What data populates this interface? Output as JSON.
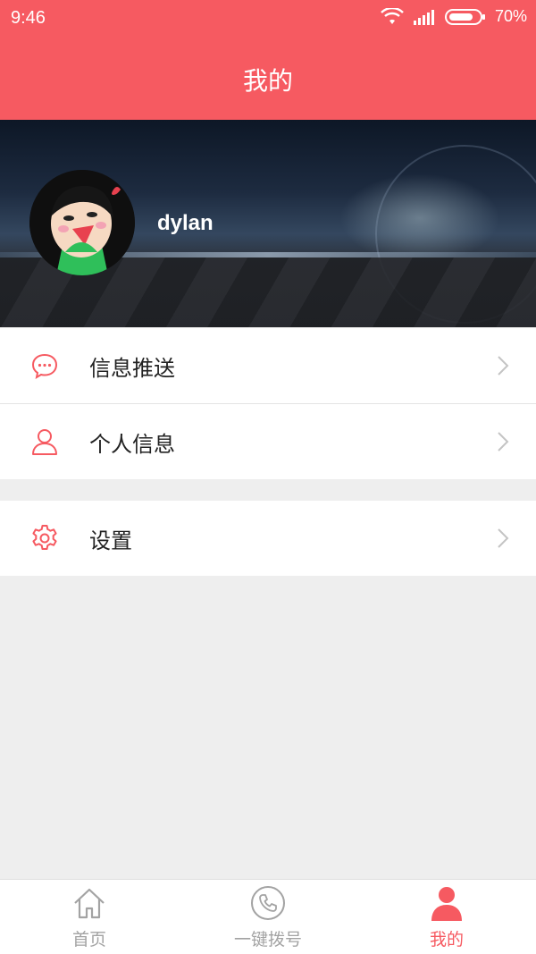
{
  "status": {
    "time": "9:46",
    "battery": "70%",
    "icons": [
      "wifi-icon",
      "signal-icon",
      "battery-icon"
    ]
  },
  "header": {
    "title": "我的"
  },
  "profile": {
    "username": "dylan"
  },
  "menu": {
    "group1": [
      {
        "label": "信息推送",
        "icon": "message-icon"
      },
      {
        "label": "个人信息",
        "icon": "user-icon"
      }
    ],
    "group2": [
      {
        "label": "设置",
        "icon": "gear-icon"
      }
    ]
  },
  "tabs": [
    {
      "label": "首页",
      "icon": "home-icon",
      "active": false
    },
    {
      "label": "一键拨号",
      "icon": "phone-icon",
      "active": false
    },
    {
      "label": "我的",
      "icon": "user-icon",
      "active": true
    }
  ],
  "colors": {
    "accent": "#f65a61",
    "background": "#eeeeee",
    "inactive": "#a3a3a3"
  }
}
